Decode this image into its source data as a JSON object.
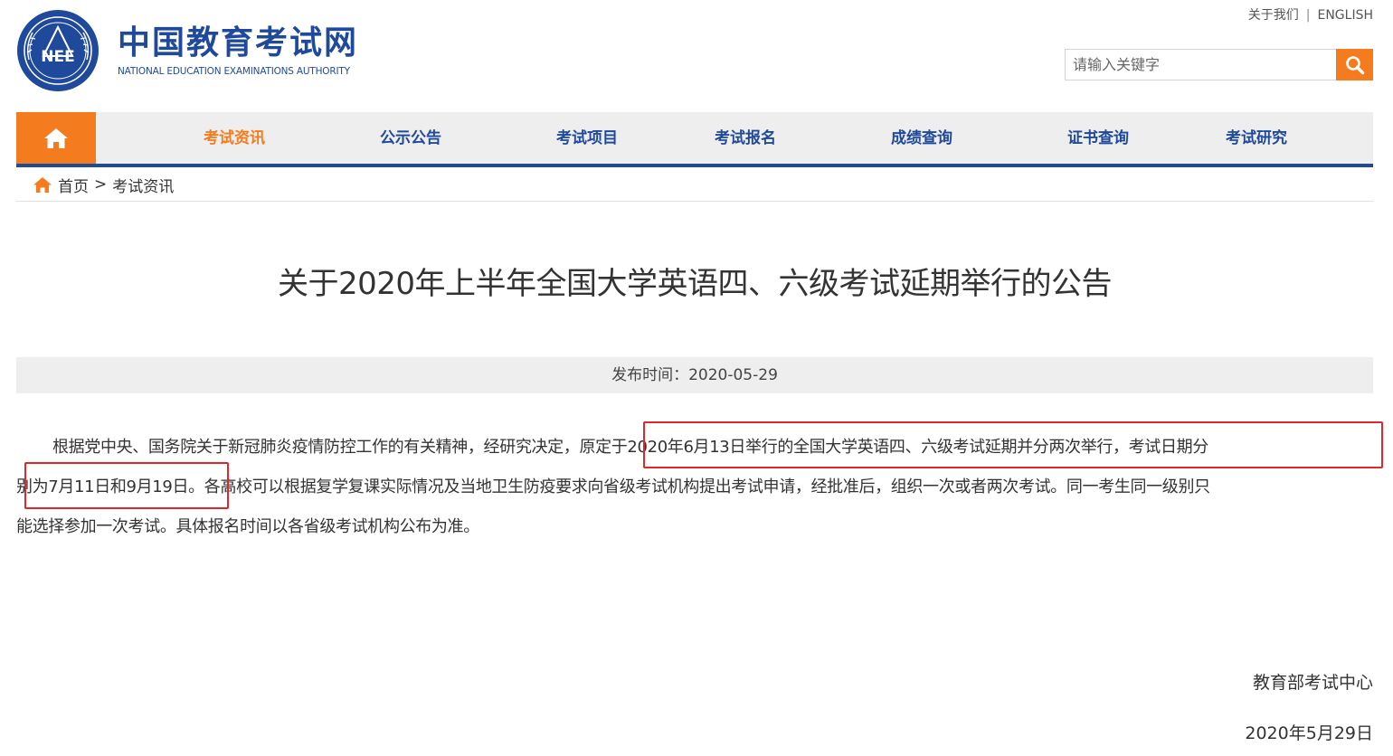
{
  "header": {
    "logo_text": "NEE",
    "brand_cn": "中国教育考试网",
    "brand_en": "NATIONAL EDUCATION EXAMINATIONS AUTHORITY",
    "top_links": [
      "关于我们",
      "ENGLISH"
    ],
    "top_sep": "|",
    "search": {
      "placeholder": "请输入关键字"
    }
  },
  "nav": {
    "items": [
      {
        "label": "考试资讯",
        "active": true
      },
      {
        "label": "公示公告"
      },
      {
        "label": "考试项目"
      },
      {
        "label": "考试报名"
      },
      {
        "label": "成绩查询"
      },
      {
        "label": "证书查询"
      },
      {
        "label": "考试研究"
      }
    ]
  },
  "breadcrumb": {
    "home": "首页",
    "sep": ">",
    "current": "考试资讯"
  },
  "article": {
    "title": "关于2020年上半年全国大学英语四、六级考试延期举行的公告",
    "publish_time": "发布时间：2020-05-29",
    "lines": [
      "根据党中央、国务院关于新冠肺炎疫情防控工作的有关精神，经研究决定，原定于2020年6月13日举行的全国大学英语四、六级考试延期并分两次举行，考试日期分",
      "别为7月11日和9月19日。各高校可以根据复学复课实际情况及当地卫生防疫要求向省级考试机构提出考试申请，经批准后，组织一次或者两次考试。同一考生同一级别只",
      "能选择参加一次考试。具体报名时间以各省级考试机构公布为准。"
    ],
    "signature": "教育部考试中心",
    "date": "2020年5月29日"
  },
  "colors": {
    "brand_blue": "#1f4a9b",
    "accent_orange": "#f47b1e",
    "highlight_red": "#e0262b"
  }
}
